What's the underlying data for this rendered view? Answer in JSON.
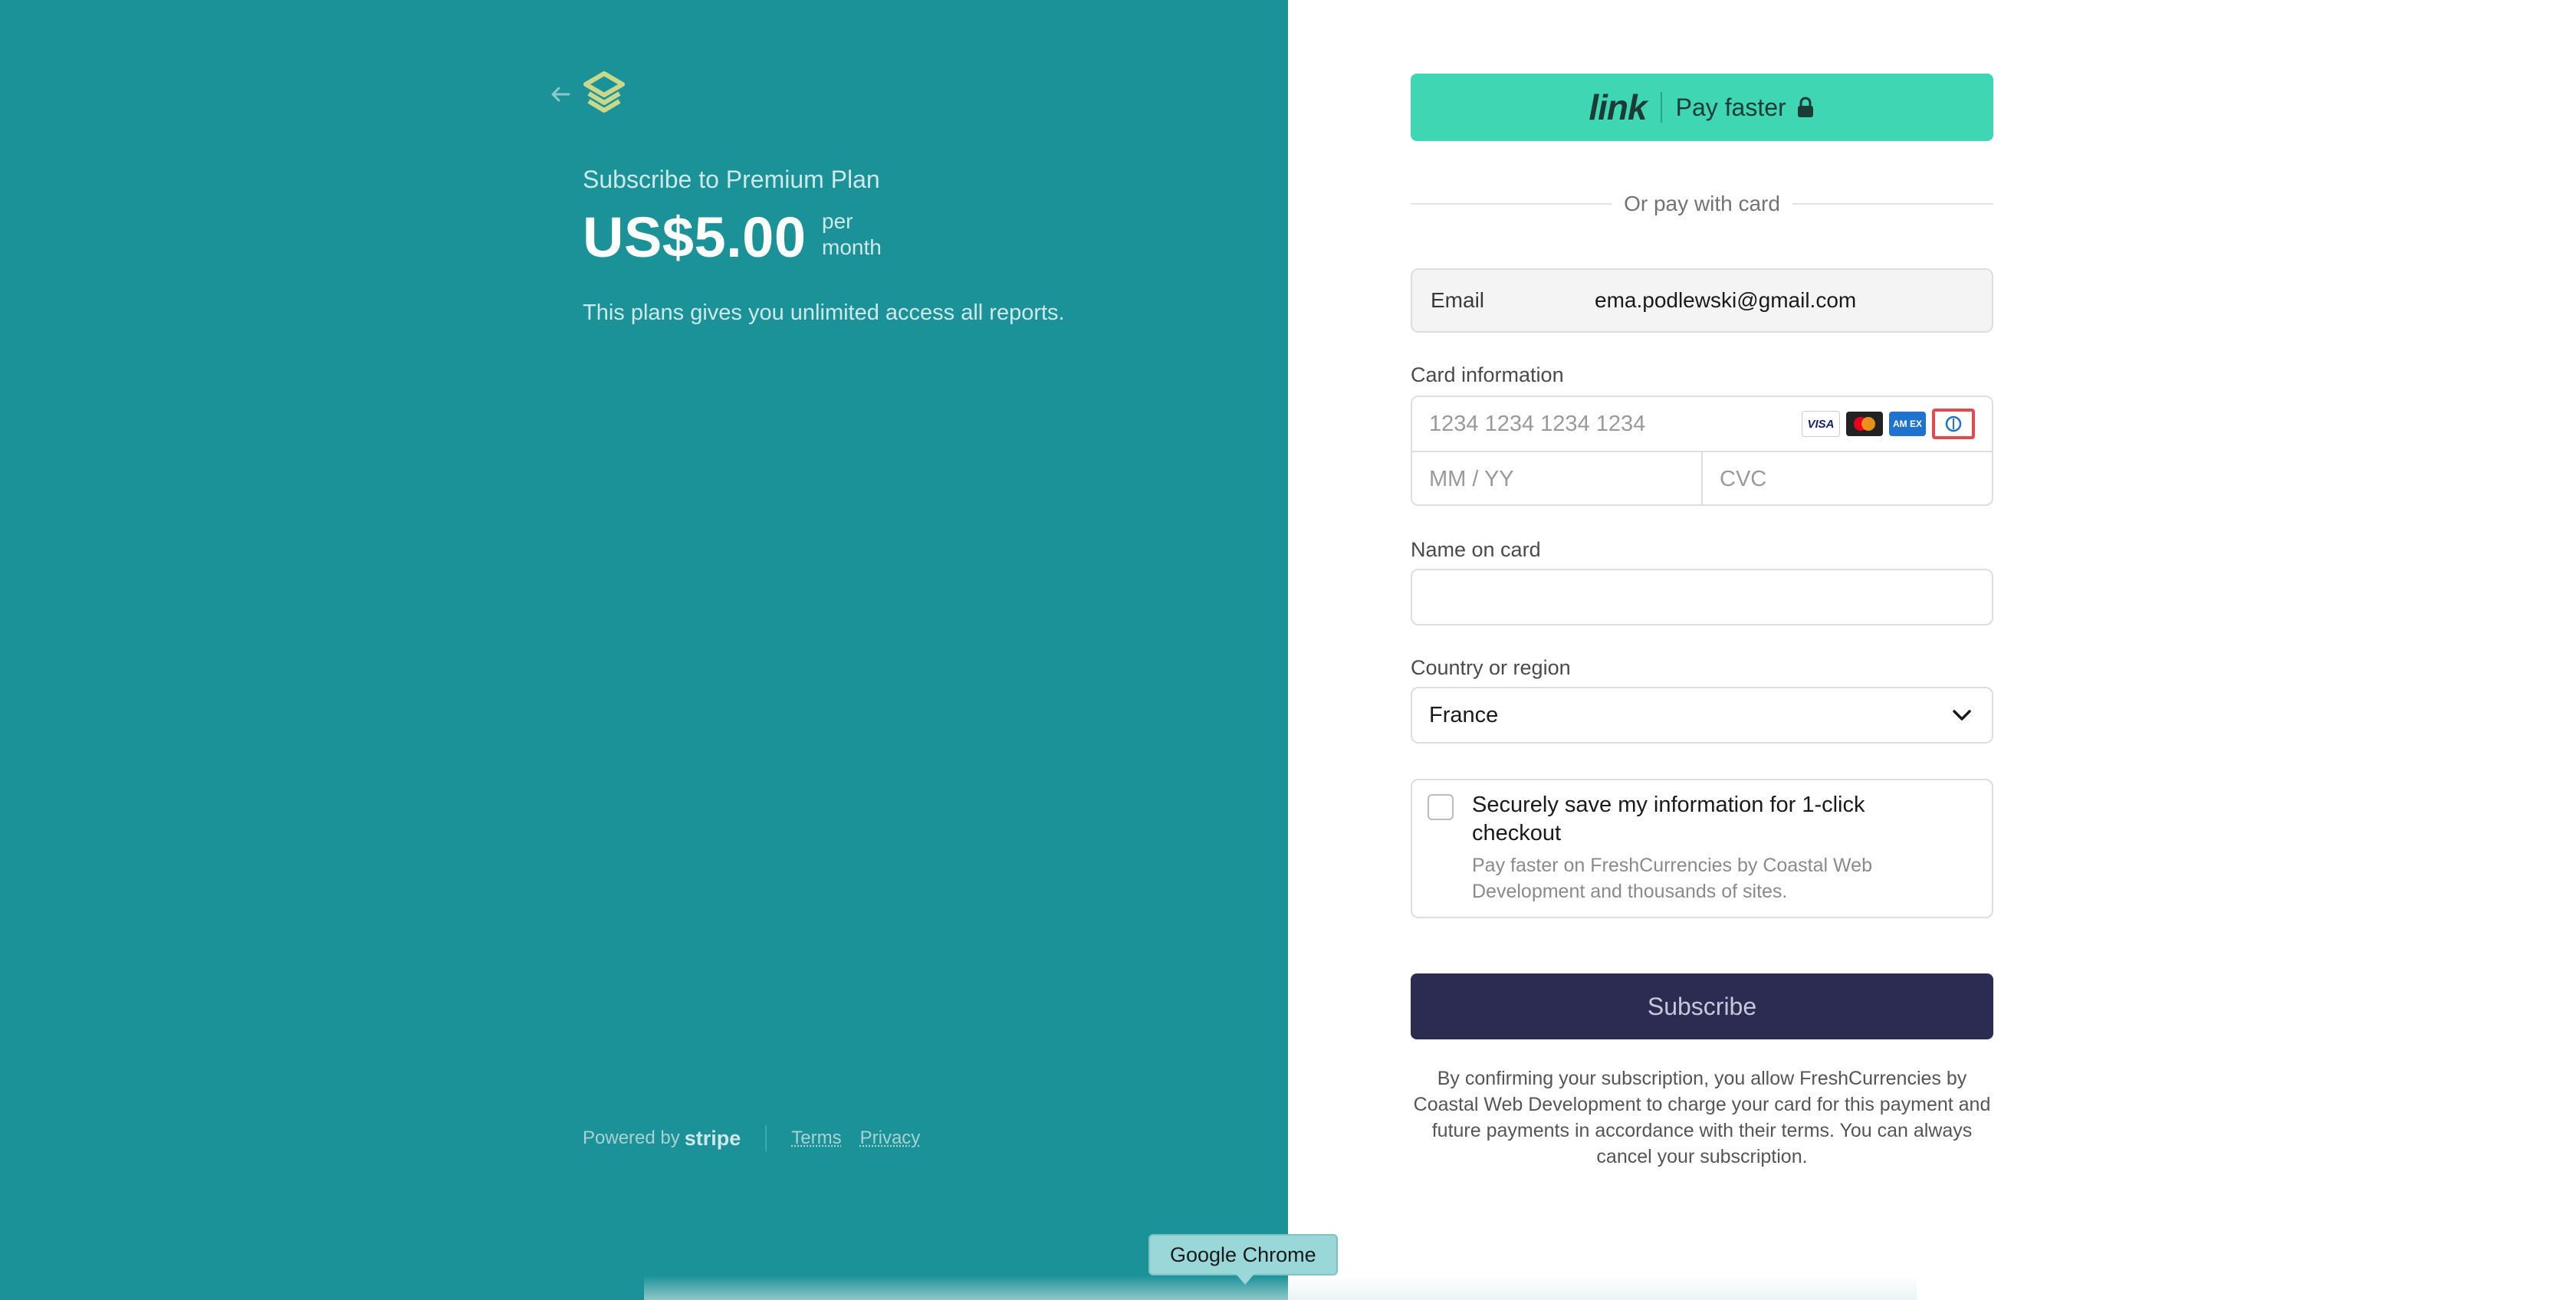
{
  "header": {
    "product_title": "Subscribe to Premium Plan",
    "price": "US$5.00",
    "period_line1": "per",
    "period_line2": "month",
    "description": "This plans gives you unlimited access all reports."
  },
  "footer": {
    "powered_by": "Powered by",
    "stripe": "stripe",
    "terms": "Terms",
    "privacy": "Privacy"
  },
  "link_button": {
    "logo": "link",
    "label": "Pay faster"
  },
  "divider_text": "Or pay with card",
  "email": {
    "label": "Email",
    "value": "ema.podlewski@gmail.com"
  },
  "card": {
    "label": "Card information",
    "number_placeholder": "1234 1234 1234 1234",
    "expiry_placeholder": "MM / YY",
    "cvc_placeholder": "CVC",
    "brands": [
      "visa",
      "mastercard",
      "amex",
      "diners"
    ],
    "visa_text": "VISA",
    "amex_text": "AM EX"
  },
  "name_on_card": {
    "label": "Name on card",
    "value": ""
  },
  "country": {
    "label": "Country or region",
    "value": "France"
  },
  "save_info": {
    "checked": false,
    "title": "Securely save my information for 1-click checkout",
    "subtitle": "Pay faster on FreshCurrencies by Coastal Web Development and thousands of sites."
  },
  "subscribe_label": "Subscribe",
  "legal": "By confirming your subscription, you allow FreshCurrencies by Coastal Web Development to charge your card for this payment and future payments in accordance with their terms. You can always cancel your subscription.",
  "tooltip": "Google Chrome",
  "colors": {
    "left_background": "#1a9297",
    "link_green": "#3ed6b3",
    "subscribe_navy": "#2c2b52"
  }
}
